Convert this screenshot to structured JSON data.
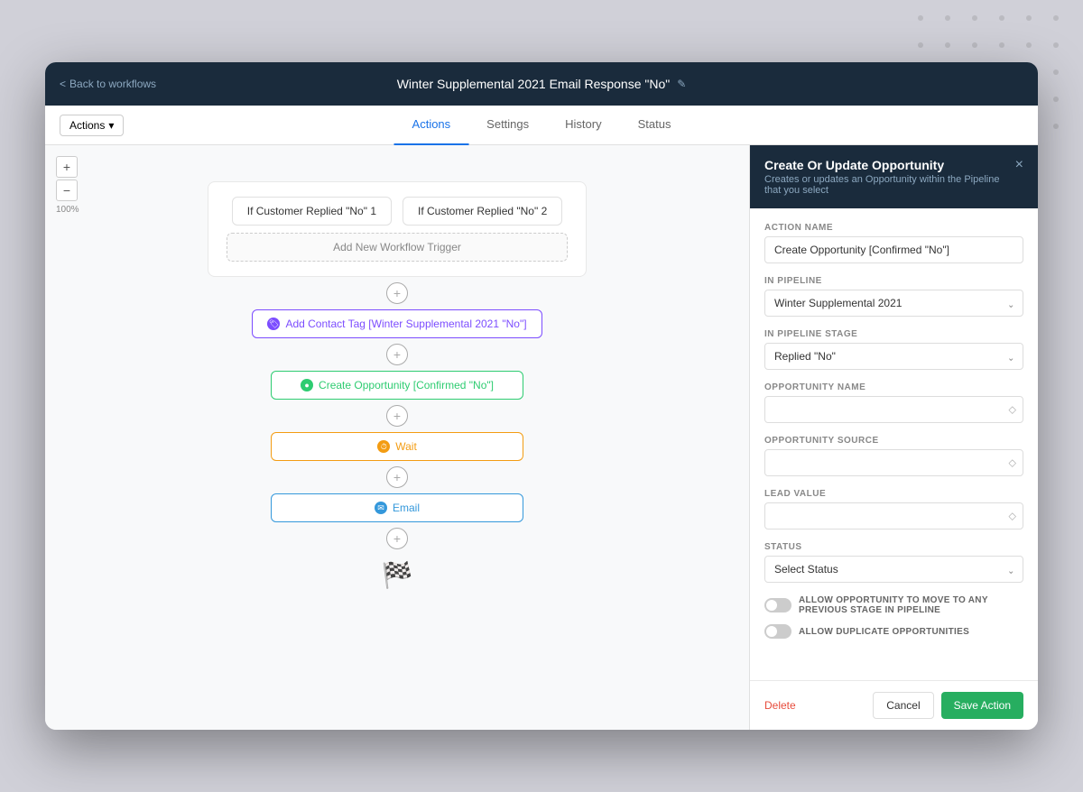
{
  "top_bar": {
    "back_label": "Back to workflows",
    "title": "Winter Supplemental 2021 Email Response \"No\"",
    "edit_icon": "✎"
  },
  "sub_nav": {
    "actions_label": "Actions",
    "tabs": [
      {
        "label": "Actions",
        "active": true
      },
      {
        "label": "Settings",
        "active": false
      },
      {
        "label": "History",
        "active": false
      },
      {
        "label": "Status",
        "active": false
      }
    ]
  },
  "zoom": {
    "plus": "+",
    "minus": "−",
    "level": "100%"
  },
  "workflow": {
    "trigger1_label": "If Customer Replied \"No\" 1",
    "trigger2_label": "If Customer Replied \"No\" 2",
    "add_trigger_label": "Add New Workflow Trigger",
    "nodes": [
      {
        "type": "tag",
        "label": "Add Contact Tag [Winter Supplemental 2021 \"No\"]"
      },
      {
        "type": "opportunity",
        "label": "Create Opportunity [Confirmed \"No\"]"
      },
      {
        "type": "wait",
        "label": "Wait"
      },
      {
        "type": "email",
        "label": "Email"
      }
    ],
    "finish_icon": "🏁"
  },
  "right_panel": {
    "title": "Create Or Update Opportunity",
    "subtitle": "Creates or updates an Opportunity within the Pipeline that you select",
    "close_icon": "×",
    "fields": {
      "action_name_label": "ACTION NAME",
      "action_name_value": "Create Opportunity [Confirmed \"No\"]",
      "in_pipeline_label": "IN PIPELINE",
      "in_pipeline_value": "Winter Supplemental 2021",
      "in_pipeline_stage_label": "IN PIPELINE STAGE",
      "in_pipeline_stage_value": "Replied \"No\"",
      "opportunity_name_label": "OPPORTUNITY NAME",
      "opportunity_name_value": "",
      "opportunity_source_label": "OPPORTUNITY SOURCE",
      "opportunity_source_value": "",
      "lead_value_label": "LEAD VALUE",
      "lead_value_value": "",
      "status_label": "STATUS",
      "status_value": "Select Status",
      "toggle1_label": "ALLOW OPPORTUNITY TO MOVE TO ANY PREVIOUS STAGE IN PIPELINE",
      "toggle2_label": "ALLOW DUPLICATE OPPORTUNITIES"
    },
    "footer": {
      "delete_label": "Delete",
      "cancel_label": "Cancel",
      "save_label": "Save Action"
    }
  }
}
